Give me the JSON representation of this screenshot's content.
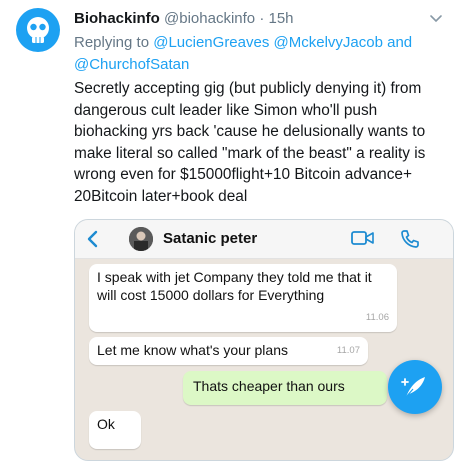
{
  "tweet": {
    "display_name": "Biohackinfo",
    "handle": "@biohackinfo",
    "separator": "·",
    "time": "15h",
    "replying_prefix": "Replying to ",
    "mentions": [
      "@LucienGreaves",
      "@MckelvyJacob",
      "and",
      "@ChurchofSatan"
    ],
    "text": "Secretly accepting gig (but publicly denying it) from dangerous cult leader like Simon who'll push biohacking yrs back 'cause he delusionally wants to make literal so called \"mark of the beast\" a reality is wrong even for $15000flight+10 Bitcoin advance+ 20Bitcoin later+book deal"
  },
  "chat": {
    "contact_name": "Satanic peter",
    "messages": [
      {
        "text": "I speak with jet Company they told me that it will   cost 15000 dollars for Everything",
        "time": "11.06"
      },
      {
        "text": "Let me know what's your plans",
        "time": "11.07"
      },
      {
        "text": "Thats cheaper than ours",
        "time": ""
      },
      {
        "text": "Ok",
        "time": ""
      }
    ]
  },
  "colors": {
    "accent": "#1da1f2",
    "chat_background": "#ebe5de",
    "outgoing_bubble": "#dcf8c6"
  },
  "icons": [
    "biohackinfo-avatar",
    "chevron-down-icon",
    "back-icon",
    "contact-avatar",
    "video-call-icon",
    "phone-icon",
    "compose-tweet-icon"
  ]
}
